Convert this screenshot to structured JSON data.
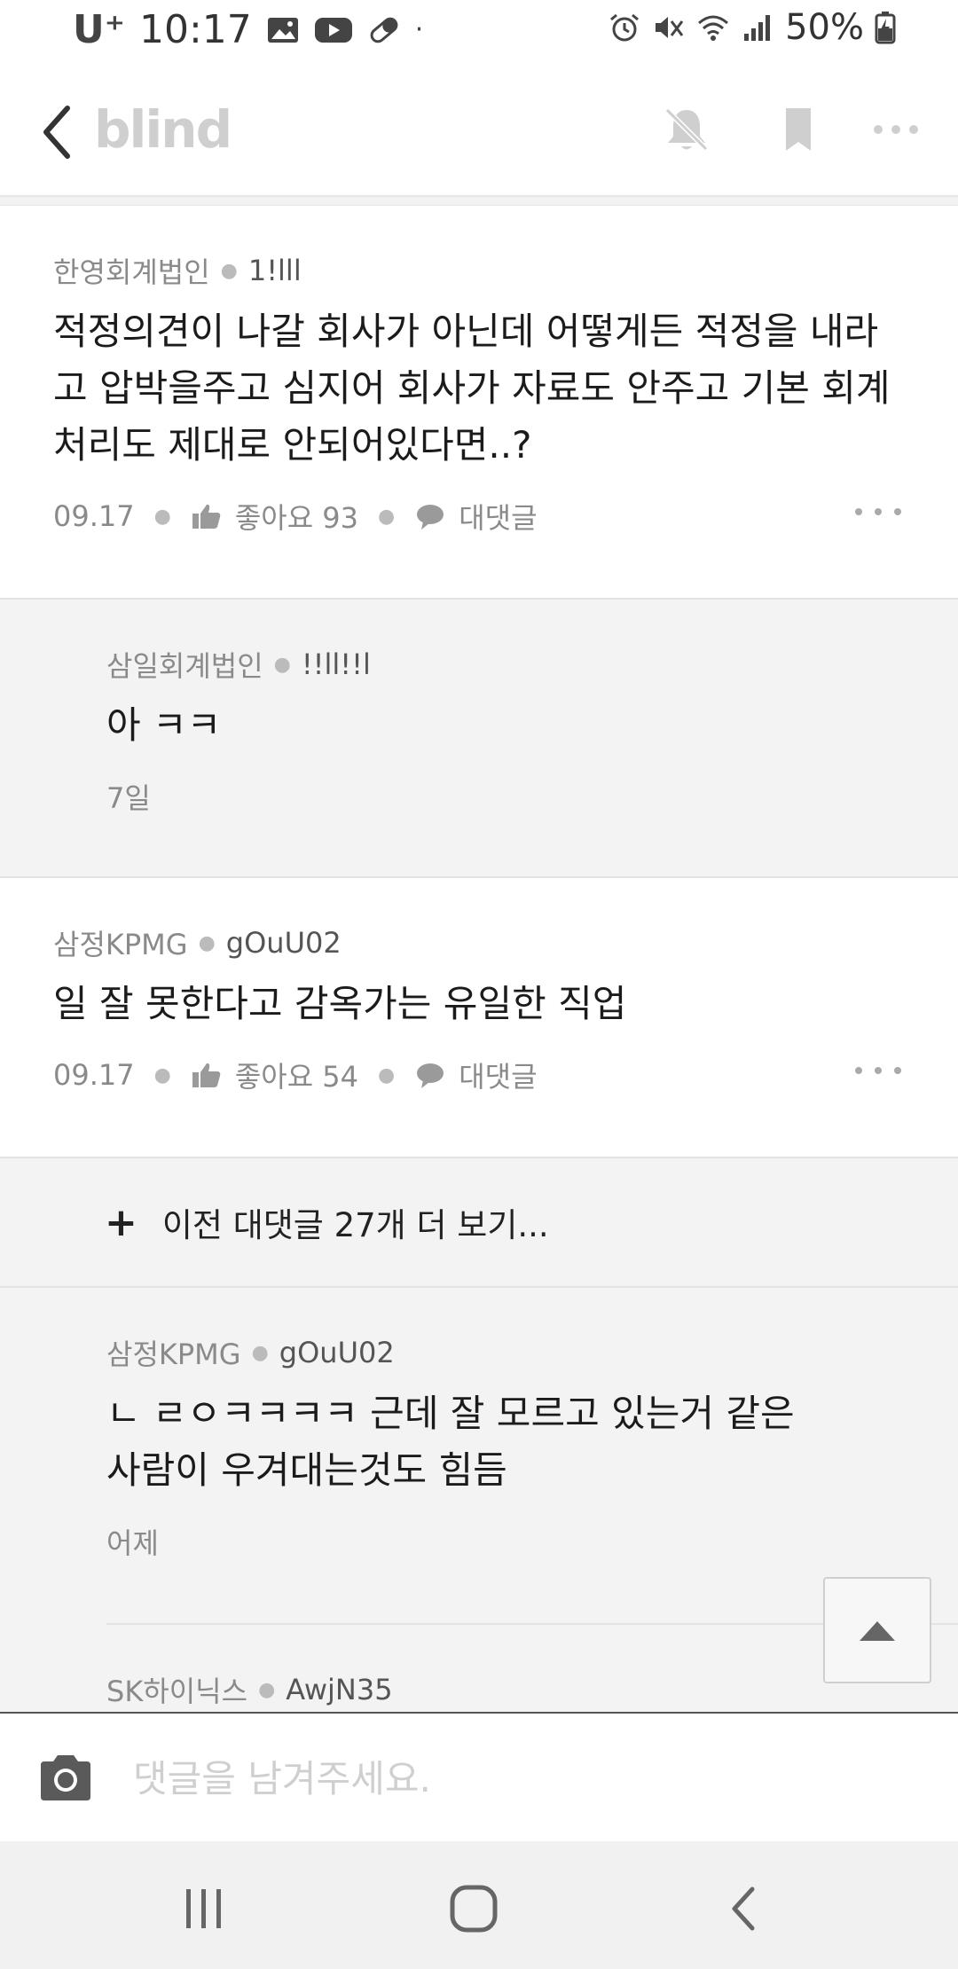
{
  "status_bar": {
    "carrier": "U⁺",
    "time": "10:17",
    "battery": "50%"
  },
  "header": {
    "logo": "blind",
    "icons": [
      "back-icon",
      "bell-off-icon",
      "bookmark-icon",
      "more-icon"
    ]
  },
  "comments": [
    {
      "company": "한영회계법인",
      "nick": "1!lll",
      "body": "적정의견이 나갈 회사가 아닌데 어떻게든 적정을 내라고 압박을주고 심지어 회사가 자료도 안주고 기본 회계처리도 제대로 안되어있다면..?",
      "date": "09.17",
      "like_label": "좋아요 93",
      "reply_label": "대댓글"
    },
    {
      "company": "삼일회계법인",
      "nick": "!!ll!!l",
      "body": "아 ㅋㅋ",
      "date": "7일"
    },
    {
      "company": "삼정KPMG",
      "nick": "gOuU02",
      "body": "일 잘 못한다고 감옥가는 유일한 직업",
      "date": "09.17",
      "like_label": "좋아요 54",
      "reply_label": "대댓글"
    },
    {
      "company": "삼정KPMG",
      "nick": "gOuU02",
      "body": "ㄴ ㄹㅇㅋㅋㅋㅋ 근데 잘 모르고 있는거 같은 사람이 우겨대는것도 힘듬",
      "date": "어제"
    },
    {
      "company": "SK하이닉스",
      "nick": "AwjN35"
    }
  ],
  "expand_label": "이전 대댓글 27개 더 보기...",
  "input": {
    "placeholder": "댓글을 남겨주세요."
  }
}
